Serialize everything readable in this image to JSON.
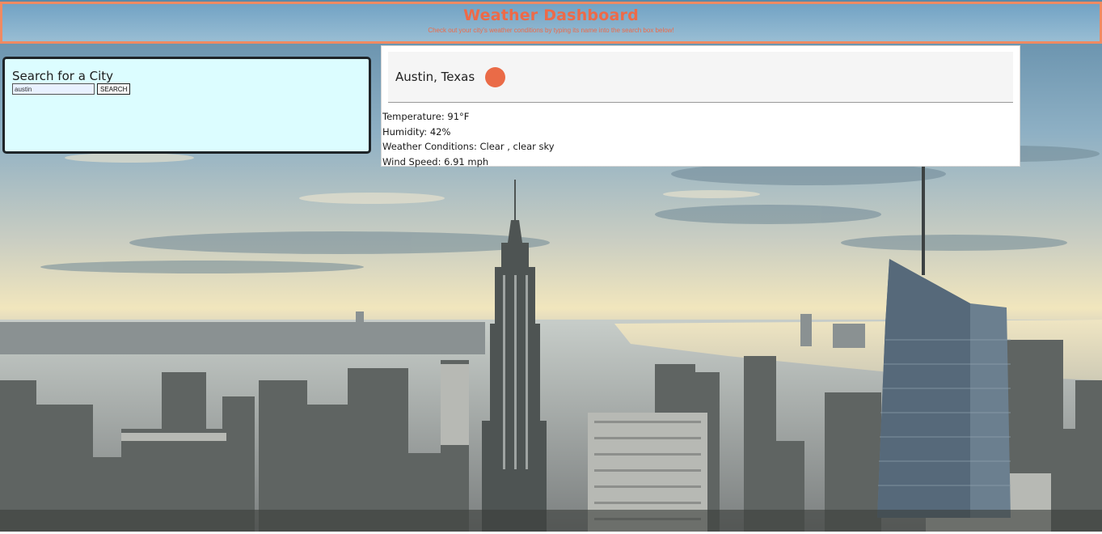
{
  "header": {
    "title": "Weather Dashboard",
    "subtitle": "Check out your city's weather conditions by typing its name into the search box below!"
  },
  "search": {
    "heading": "Search for a City",
    "input_value": "austin",
    "button_label": "SEARCH"
  },
  "result": {
    "city": "Austin, Texas",
    "icon": "sun-icon",
    "temperature": "Temperature: 91°F",
    "humidity": "Humidity: 42%",
    "conditions": "Weather Conditions: Clear , clear sky",
    "wind": "Wind Speed: 6.91 mph"
  },
  "colors": {
    "accent": "#ee6a48",
    "header_border": "#f08a62",
    "search_panel_bg": "#dcfdff",
    "sun_icon": "#ea6b47"
  }
}
